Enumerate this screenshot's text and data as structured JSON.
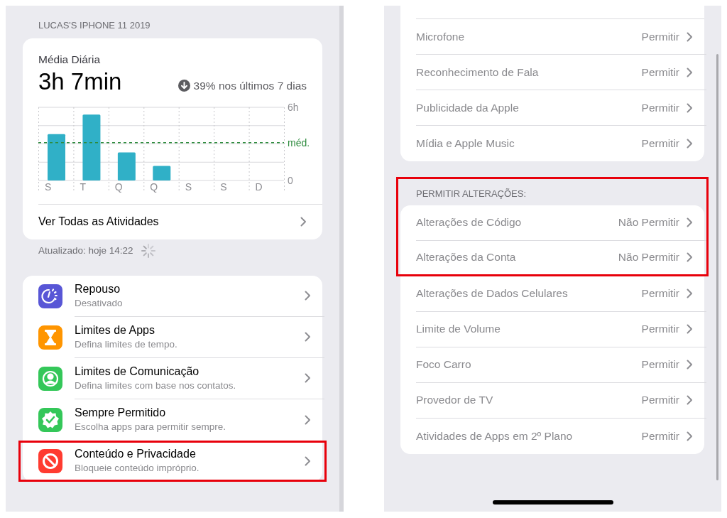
{
  "left": {
    "device_header": "LUCAS'S IPHONE 11 2019",
    "summary": {
      "label": "Média Diária",
      "value": "3h 7min",
      "trend": "39% nos últimos 7 dias",
      "chart_data": {
        "type": "bar",
        "categories": [
          "S",
          "T",
          "Q",
          "Q",
          "S",
          "S",
          "D"
        ],
        "values": [
          3.8,
          5.4,
          2.3,
          1.2,
          null,
          null,
          null
        ],
        "ylim": [
          0,
          6
        ],
        "yticks": [
          {
            "value": 0,
            "label": "0"
          },
          {
            "value": 6,
            "label": "6h"
          }
        ],
        "ref_lines": [
          {
            "axis": "y",
            "value": 3.1,
            "label": "méd."
          }
        ]
      },
      "link": "Ver Todas as Atividades"
    },
    "updated": "Atualizado: hoje 14:22",
    "items": [
      {
        "kind": "downtime",
        "color": "#5856d6",
        "title": "Repouso",
        "subtitle": "Desativado",
        "highlighted": false
      },
      {
        "kind": "hourglass",
        "color": "#ff9500",
        "title": "Limites de Apps",
        "subtitle": "Defina limites de tempo.",
        "highlighted": false
      },
      {
        "kind": "person",
        "color": "#34c759",
        "title": "Limites de Comunicação",
        "subtitle": "Defina limites com base nos contatos.",
        "highlighted": false
      },
      {
        "kind": "check",
        "color": "#34c759",
        "title": "Sempre Permitido",
        "subtitle": "Escolha apps para permitir sempre.",
        "highlighted": false
      },
      {
        "kind": "block",
        "color": "#ff3b30",
        "title": "Conteúdo e Privacidade",
        "subtitle": "Bloqueie conteúdo impróprio.",
        "highlighted": true
      }
    ]
  },
  "right": {
    "sections": [
      {
        "rows": [
          {
            "label": "Microfone",
            "value": "Permitir",
            "highlighted": false
          },
          {
            "label": "Reconhecimento de Fala",
            "value": "Permitir",
            "highlighted": false
          },
          {
            "label": "Publicidade da Apple",
            "value": "Permitir",
            "highlighted": false
          },
          {
            "label": "Mídia e Apple Music",
            "value": "Permitir",
            "highlighted": false
          }
        ]
      },
      {
        "header": "PERMITIR ALTERAÇÕES:",
        "header_highlighted": true,
        "rows": [
          {
            "label": "Alterações de Código",
            "value": "Não Permitir",
            "highlighted": true
          },
          {
            "label": "Alterações da Conta",
            "value": "Não Permitir",
            "highlighted": true
          },
          {
            "label": "Alterações de Dados Celulares",
            "value": "Permitir",
            "highlighted": false
          },
          {
            "label": "Limite de Volume",
            "value": "Permitir",
            "highlighted": false
          },
          {
            "label": "Foco Carro",
            "value": "Permitir",
            "highlighted": false
          },
          {
            "label": "Provedor de TV",
            "value": "Permitir",
            "highlighted": false
          },
          {
            "label": "Atividades de Apps em 2º Plano",
            "value": "Permitir",
            "highlighted": false
          }
        ]
      }
    ]
  }
}
